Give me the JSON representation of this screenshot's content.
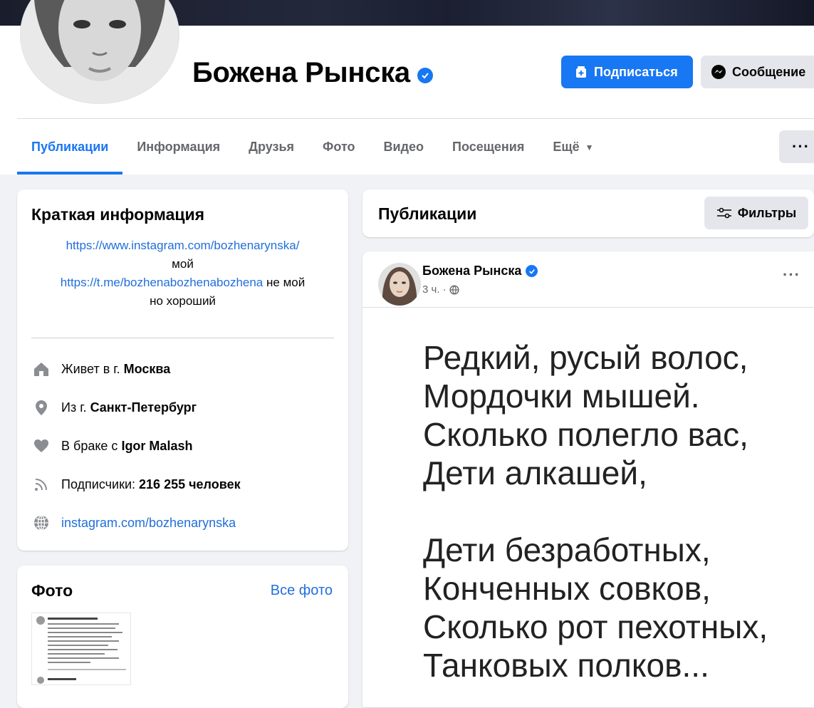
{
  "profile": {
    "name": "Божена Рынска",
    "subscribe_label": "Подписаться",
    "message_label": "Сообщение"
  },
  "tabs": [
    {
      "label": "Публикации",
      "active": true
    },
    {
      "label": "Информация"
    },
    {
      "label": "Друзья"
    },
    {
      "label": "Фото"
    },
    {
      "label": "Видео"
    },
    {
      "label": "Посещения"
    },
    {
      "label": "Ещё"
    }
  ],
  "more_label": "···",
  "intro": {
    "title": "Краткая информация",
    "bio_link1": "https://www.instagram.com/bozhenarynska/",
    "bio_text1": "мой",
    "bio_link2": "https://t.me/bozhenabozhenabozhena",
    "bio_text2": "не мой",
    "bio_text3": "но хороший",
    "lives_prefix": "Живет в г.",
    "lives_value": "Москва",
    "from_prefix": "Из г.",
    "from_value": "Санкт-Петербург",
    "married_prefix": "В браке с",
    "married_value": "Igor Malash",
    "followers_prefix": "Подписчики:",
    "followers_value": "216 255 человек",
    "website": "instagram.com/bozhenarynska"
  },
  "photos": {
    "title": "Фото",
    "see_all": "Все фото"
  },
  "posts_section": {
    "title": "Публикации",
    "filters_label": "Фильтры"
  },
  "post": {
    "author": "Божена Рынска",
    "time": "3 ч. ·",
    "dots": "···",
    "lines": [
      "Редкий, русый волос,",
      "Мордочки мышей.",
      "Сколько полегло вас,",
      "Дети алкашей,",
      "",
      "Дети безработных,",
      "Конченных совков,",
      "Сколько рот пехотных,",
      "Танковых полков..."
    ]
  },
  "colors": {
    "accent": "#1877f2",
    "link": "#216fdb",
    "background": "#f0f2f5",
    "secondary_text": "#65676b"
  },
  "icons": {
    "home": "home-icon",
    "pin": "location-pin-icon",
    "heart": "heart-icon",
    "rss": "rss-feed-icon",
    "globe": "globe-icon",
    "verified": "verified-badge-icon",
    "messenger": "messenger-icon",
    "subscribe": "subscribe-icon",
    "filters": "filters-icon"
  }
}
